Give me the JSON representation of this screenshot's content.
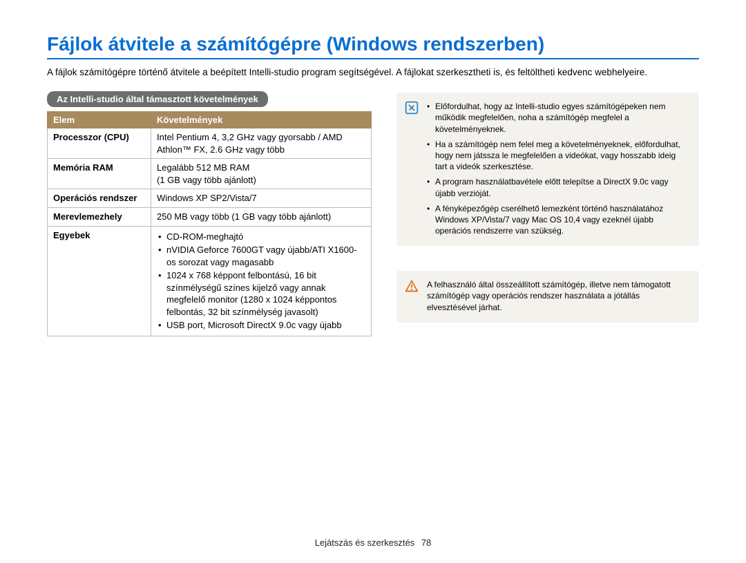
{
  "title": "Fájlok átvitele a számítógépre (Windows rendszerben)",
  "intro": "A fájlok számítógépre történő átvitele a beépített Intelli-studio program segítségével. A fájlokat szerkesztheti is, és feltöltheti kedvenc webhelyeire.",
  "section_heading": "Az Intelli-studio által támasztott követelmények",
  "table": {
    "header": {
      "col1": "Elem",
      "col2": "Követelmények"
    },
    "rows": {
      "cpu": {
        "label": "Processzor (CPU)",
        "value": "Intel Pentium 4, 3,2 GHz vagy gyorsabb / AMD Athlon™ FX, 2.6 GHz vagy több"
      },
      "ram": {
        "label": "Memória RAM",
        "line1": "Legalább 512 MB RAM",
        "line2": "(1 GB vagy több ajánlott)"
      },
      "os": {
        "label": "Operációs rendszer",
        "value": "Windows XP SP2/Vista/7"
      },
      "hdd": {
        "label": "Merevlemezhely",
        "value": "250 MB vagy több (1 GB vagy több ajánlott)"
      },
      "other": {
        "label": "Egyebek",
        "item1": "CD-ROM-meghajtó",
        "item2": "nVIDIA Geforce 7600GT vagy újabb/ATI X1600-os sorozat vagy magasabb",
        "item3": "1024 x 768 képpont felbontású, 16 bit színmélységű színes kijelző vagy annak megfelelő monitor (1280 x 1024 képpontos felbontás, 32 bit színmélység javasolt)",
        "item4": "USB port, Microsoft DirectX 9.0c vagy újabb"
      }
    }
  },
  "note": {
    "item1": "Előfordulhat, hogy az Intelli-studio egyes számítógépeken nem működik megfelelően, noha a számítógép megfelel a követelményeknek.",
    "item2": "Ha a számítógép nem felel meg a követelményeknek, előfordulhat, hogy nem játssza le megfelelően a videókat, vagy hosszabb ideig tart a videók szerkesztése.",
    "item3": "A program használatbavétele előtt telepítse a DirectX 9.0c vagy újabb verzióját.",
    "item4": "A fényképezőgép cserélhető lemezként történő használatához Windows XP/Vista/7 vagy Mac OS 10,4 vagy ezeknél újabb operációs rendszerre van szükség."
  },
  "warning": {
    "text": "A felhasználó által összeállított számítógép, illetve nem támogatott számítógép vagy operációs rendszer használata a jótállás elvesztésével járhat."
  },
  "footer": {
    "section": "Lejátszás és szerkesztés",
    "page": "78"
  }
}
